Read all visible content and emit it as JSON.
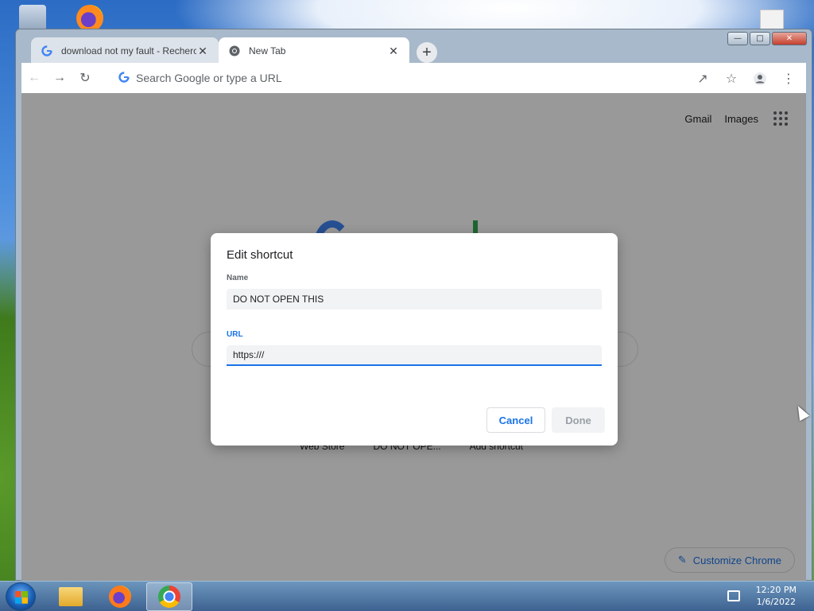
{
  "browser": {
    "tabs": [
      {
        "title": "download not my fault - Recherc",
        "favicon": "google-g-icon",
        "active": false
      },
      {
        "title": "New Tab",
        "favicon": "chrome-icon",
        "active": true
      }
    ],
    "omnibox": {
      "placeholder": "Search Google or type a URL"
    }
  },
  "page": {
    "top_links": {
      "gmail": "Gmail",
      "images": "Images"
    },
    "shortcuts": [
      "Web Store",
      "DO NOT OPE...",
      "Add shortcut"
    ],
    "customize_label": "Customize Chrome"
  },
  "dialog": {
    "title": "Edit shortcut",
    "name_label": "Name",
    "name_value": "DO NOT OPEN THIS",
    "url_label": "URL",
    "url_value": "https:///",
    "cancel_label": "Cancel",
    "done_label": "Done"
  },
  "taskbar": {
    "time": "12:20 PM",
    "date": "1/6/2022",
    "items": [
      "file-explorer",
      "firefox",
      "chrome"
    ]
  },
  "colors": {
    "accent": "#1a73e8",
    "scrim": "rgba(0,0,0,0.4)"
  }
}
